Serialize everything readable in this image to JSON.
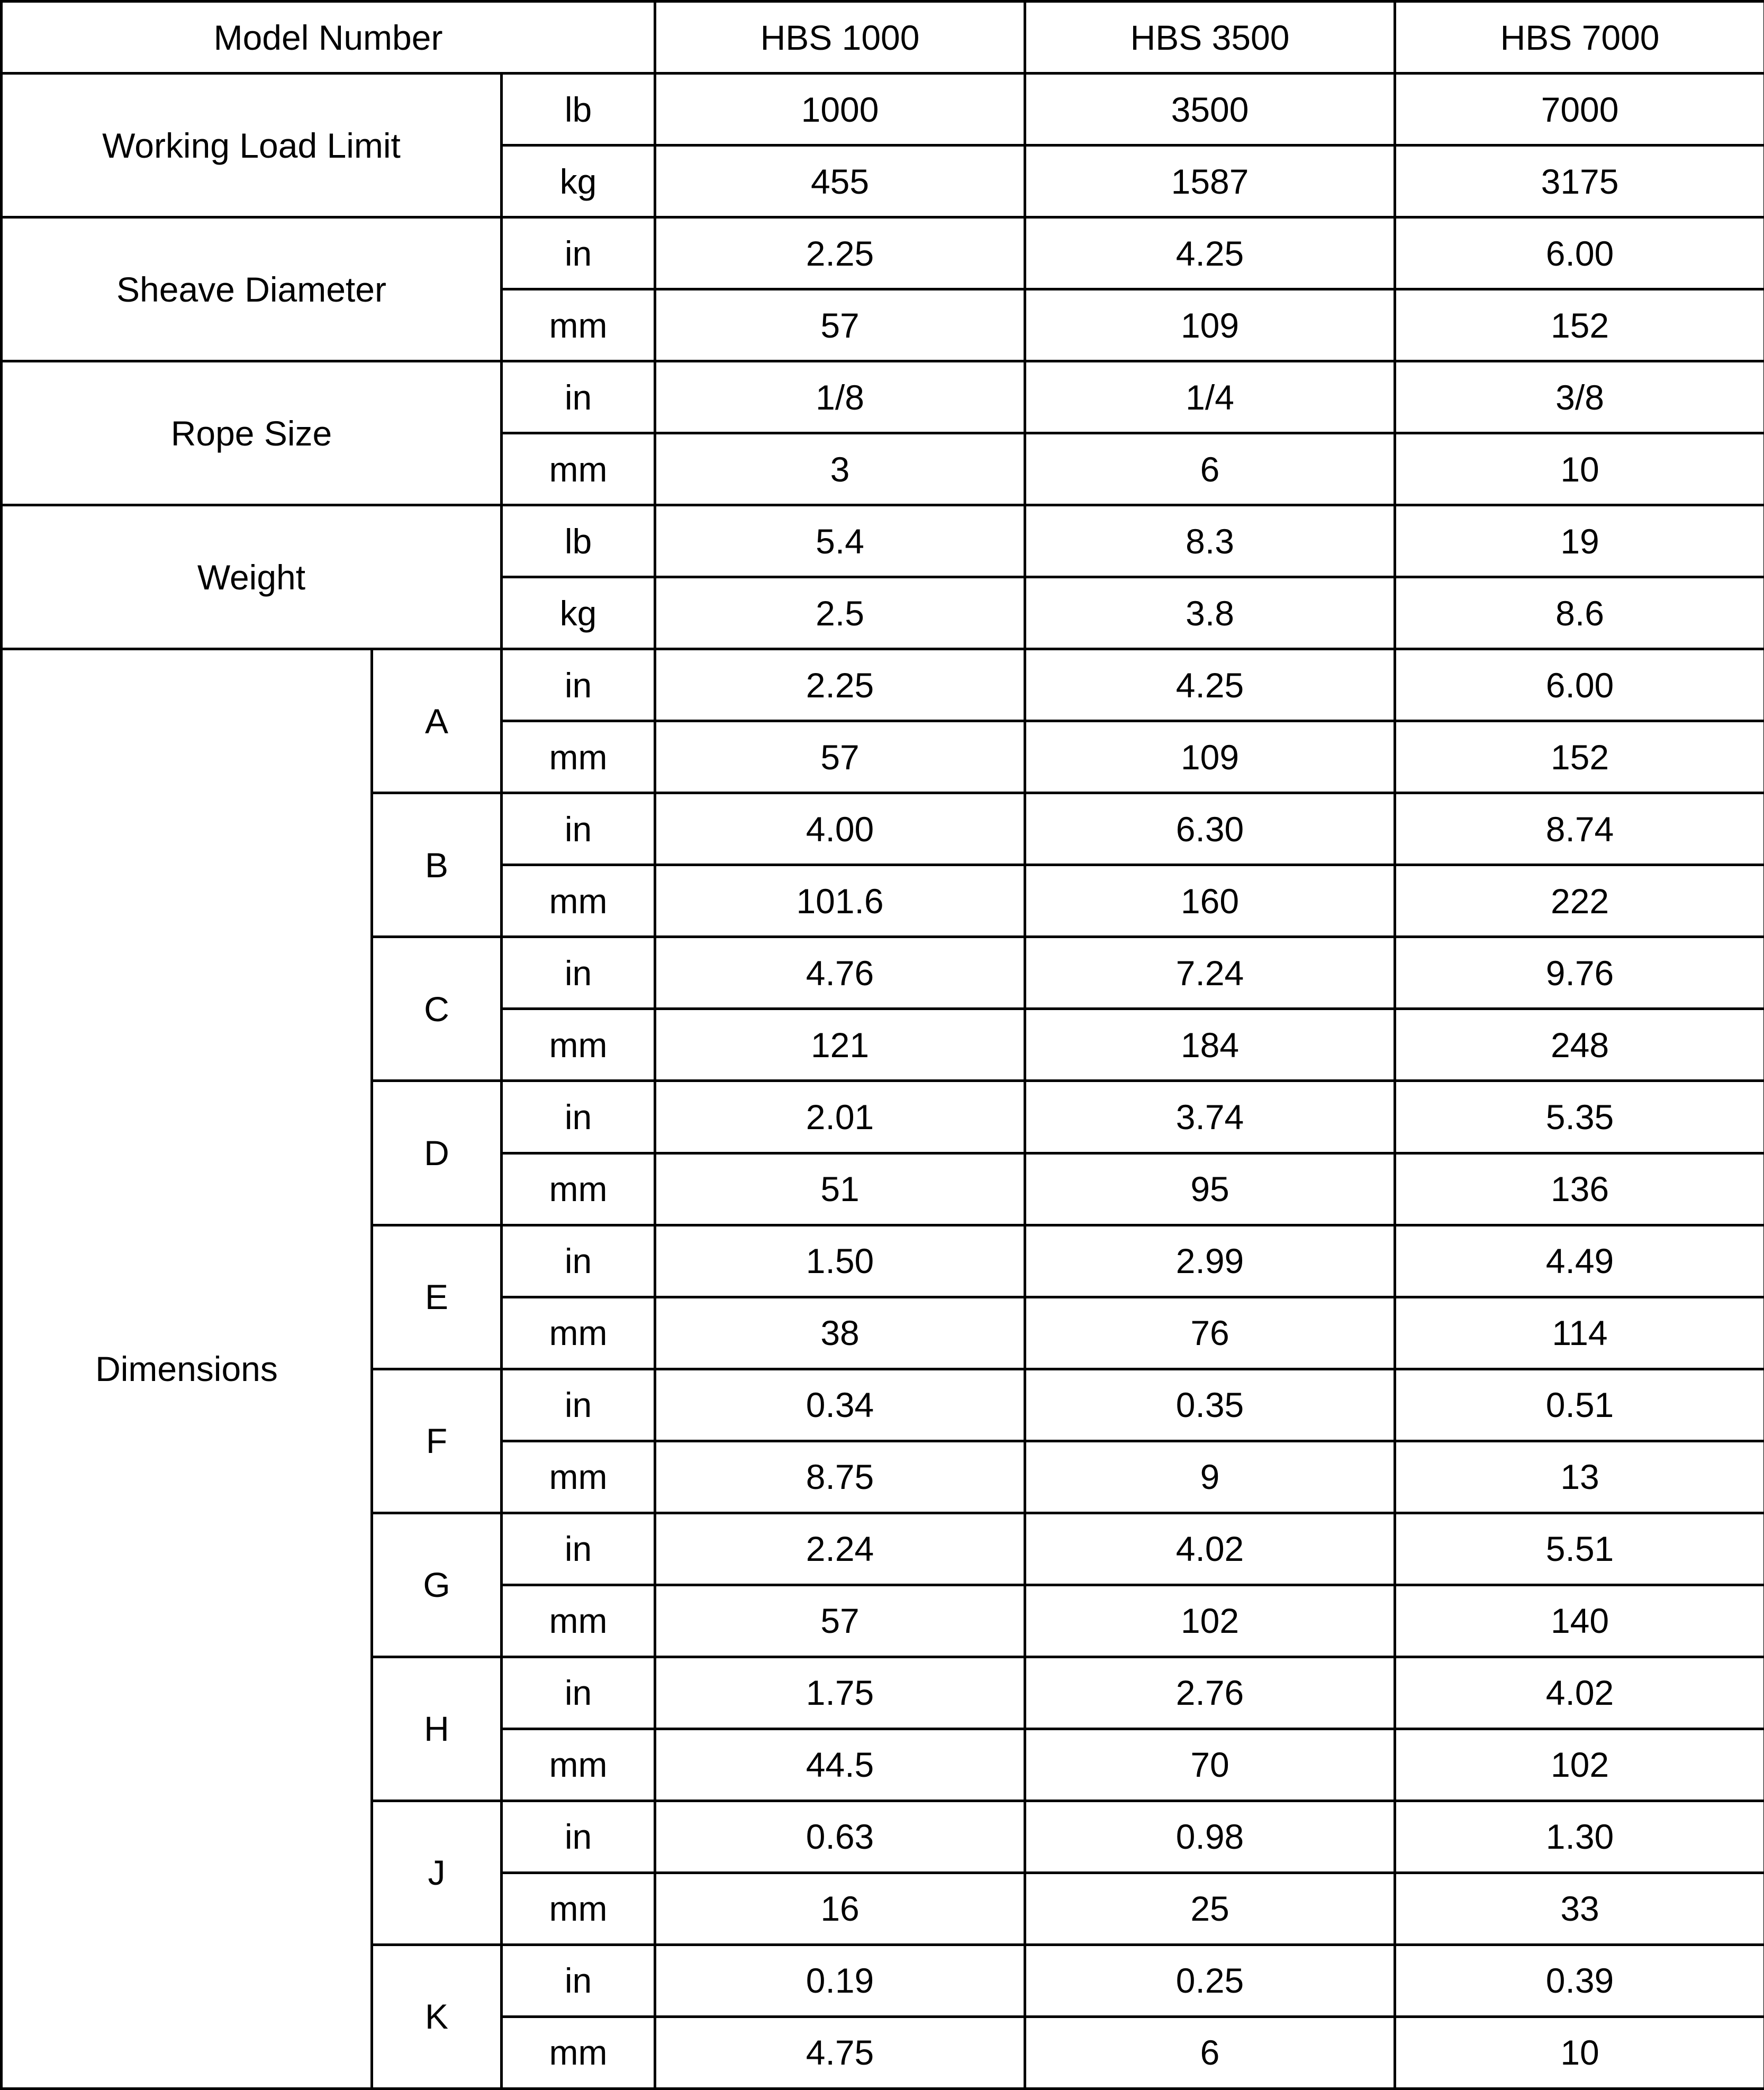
{
  "table": {
    "header": {
      "row_label": "Model Number",
      "columns": [
        "HBS 1000",
        "HBS 3500",
        "HBS 7000"
      ]
    },
    "colors": {
      "header_bg": "#1a1a1a",
      "header_text": "#ffffff",
      "group_label_bg": "#636363",
      "letter_label_bg": "#8a8a8a",
      "cell_bg": "#ffffff",
      "border": "#000000"
    },
    "simple_groups": [
      {
        "label": "Working Load Limit",
        "rows": [
          {
            "unit": "lb",
            "values": [
              "1000",
              "3500",
              "7000"
            ]
          },
          {
            "unit": "kg",
            "values": [
              "455",
              "1587",
              "3175"
            ]
          }
        ]
      },
      {
        "label": "Sheave Diameter",
        "rows": [
          {
            "unit": "in",
            "values": [
              "2.25",
              "4.25",
              "6.00"
            ]
          },
          {
            "unit": "mm",
            "values": [
              "57",
              "109",
              "152"
            ]
          }
        ]
      },
      {
        "label": "Rope Size",
        "rows": [
          {
            "unit": "in",
            "values": [
              "1/8",
              "1/4",
              "3/8"
            ]
          },
          {
            "unit": "mm",
            "values": [
              "3",
              "6",
              "10"
            ]
          }
        ]
      },
      {
        "label": "Weight",
        "rows": [
          {
            "unit": "lb",
            "values": [
              "5.4",
              "8.3",
              "19"
            ]
          },
          {
            "unit": "kg",
            "values": [
              "2.5",
              "3.8",
              "8.6"
            ]
          }
        ]
      }
    ],
    "dimensions": {
      "label": "Dimensions",
      "groups": [
        {
          "letter": "A",
          "rows": [
            {
              "unit": "in",
              "values": [
                "2.25",
                "4.25",
                "6.00"
              ]
            },
            {
              "unit": "mm",
              "values": [
                "57",
                "109",
                "152"
              ]
            }
          ]
        },
        {
          "letter": "B",
          "rows": [
            {
              "unit": "in",
              "values": [
                "4.00",
                "6.30",
                "8.74"
              ]
            },
            {
              "unit": "mm",
              "values": [
                "101.6",
                "160",
                "222"
              ]
            }
          ]
        },
        {
          "letter": "C",
          "rows": [
            {
              "unit": "in",
              "values": [
                "4.76",
                "7.24",
                "9.76"
              ]
            },
            {
              "unit": "mm",
              "values": [
                "121",
                "184",
                "248"
              ]
            }
          ]
        },
        {
          "letter": "D",
          "rows": [
            {
              "unit": "in",
              "values": [
                "2.01",
                "3.74",
                "5.35"
              ]
            },
            {
              "unit": "mm",
              "values": [
                "51",
                "95",
                "136"
              ]
            }
          ]
        },
        {
          "letter": "E",
          "rows": [
            {
              "unit": "in",
              "values": [
                "1.50",
                "2.99",
                "4.49"
              ]
            },
            {
              "unit": "mm",
              "values": [
                "38",
                "76",
                "114"
              ]
            }
          ]
        },
        {
          "letter": "F",
          "rows": [
            {
              "unit": "in",
              "values": [
                "0.34",
                "0.35",
                "0.51"
              ]
            },
            {
              "unit": "mm",
              "values": [
                "8.75",
                "9",
                "13"
              ]
            }
          ]
        },
        {
          "letter": "G",
          "rows": [
            {
              "unit": "in",
              "values": [
                "2.24",
                "4.02",
                "5.51"
              ]
            },
            {
              "unit": "mm",
              "values": [
                "57",
                "102",
                "140"
              ]
            }
          ]
        },
        {
          "letter": "H",
          "rows": [
            {
              "unit": "in",
              "values": [
                "1.75",
                "2.76",
                "4.02"
              ]
            },
            {
              "unit": "mm",
              "values": [
                "44.5",
                "70",
                "102"
              ]
            }
          ]
        },
        {
          "letter": "J",
          "rows": [
            {
              "unit": "in",
              "values": [
                "0.63",
                "0.98",
                "1.30"
              ]
            },
            {
              "unit": "mm",
              "values": [
                "16",
                "25",
                "33"
              ]
            }
          ]
        },
        {
          "letter": "K",
          "rows": [
            {
              "unit": "in",
              "values": [
                "0.19",
                "0.25",
                "0.39"
              ]
            },
            {
              "unit": "mm",
              "values": [
                "4.75",
                "6",
                "10"
              ]
            }
          ]
        }
      ]
    }
  }
}
